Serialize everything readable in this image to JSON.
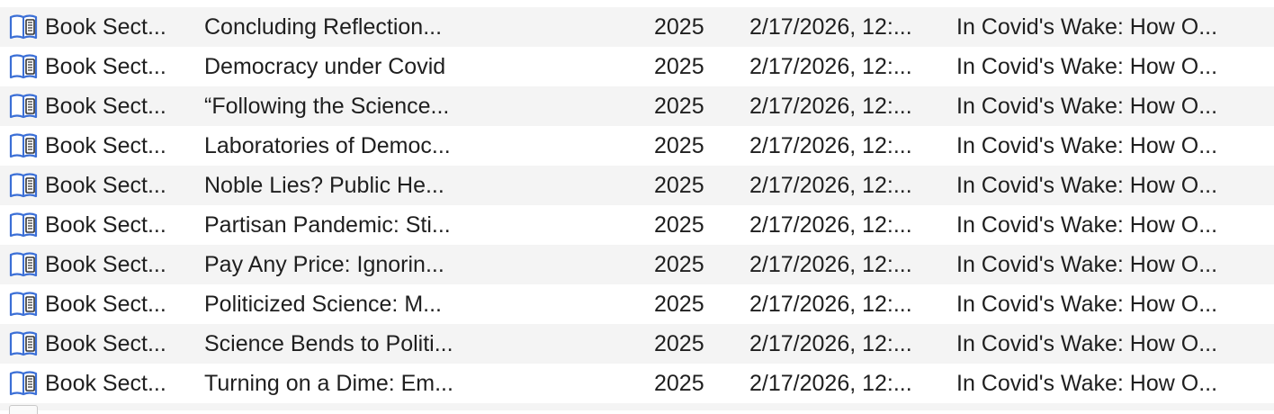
{
  "colors": {
    "row_alt": "#f4f4f4",
    "row": "#ffffff",
    "text": "#1f1f1f",
    "icon_blue": "#3b6fd6"
  },
  "icons": {
    "item_type": "book-section-icon"
  },
  "rows": [
    {
      "type": "Book Sect...",
      "title": "Concluding Reflection...",
      "year": "2025",
      "date_added": "2/17/2026, 12:...",
      "publication": "In Covid's Wake: How O..."
    },
    {
      "type": "Book Sect...",
      "title": "Democracy under Covid",
      "year": "2025",
      "date_added": "2/17/2026, 12:...",
      "publication": "In Covid's Wake: How O..."
    },
    {
      "type": "Book Sect...",
      "title": "“Following the Science...",
      "year": "2025",
      "date_added": "2/17/2026, 12:...",
      "publication": "In Covid's Wake: How O..."
    },
    {
      "type": "Book Sect...",
      "title": "Laboratories of Democ...",
      "year": "2025",
      "date_added": "2/17/2026, 12:...",
      "publication": "In Covid's Wake: How O..."
    },
    {
      "type": "Book Sect...",
      "title": "Noble Lies? Public He...",
      "year": "2025",
      "date_added": "2/17/2026, 12:...",
      "publication": "In Covid's Wake: How O..."
    },
    {
      "type": "Book Sect...",
      "title": "Partisan Pandemic: Sti...",
      "year": "2025",
      "date_added": "2/17/2026, 12:...",
      "publication": "In Covid's Wake: How O..."
    },
    {
      "type": "Book Sect...",
      "title": "Pay Any Price: Ignorin...",
      "year": "2025",
      "date_added": "2/17/2026, 12:...",
      "publication": "In Covid's Wake: How O..."
    },
    {
      "type": "Book Sect...",
      "title": "Politicized Science: M...",
      "year": "2025",
      "date_added": "2/17/2026, 12:...",
      "publication": "In Covid's Wake: How O..."
    },
    {
      "type": "Book Sect...",
      "title": "Science Bends to Politi...",
      "year": "2025",
      "date_added": "2/17/2026, 12:...",
      "publication": "In Covid's Wake: How O..."
    },
    {
      "type": "Book Sect...",
      "title": "Turning on a Dime: Em...",
      "year": "2025",
      "date_added": "2/17/2026, 12:...",
      "publication": "In Covid's Wake: How O..."
    }
  ]
}
